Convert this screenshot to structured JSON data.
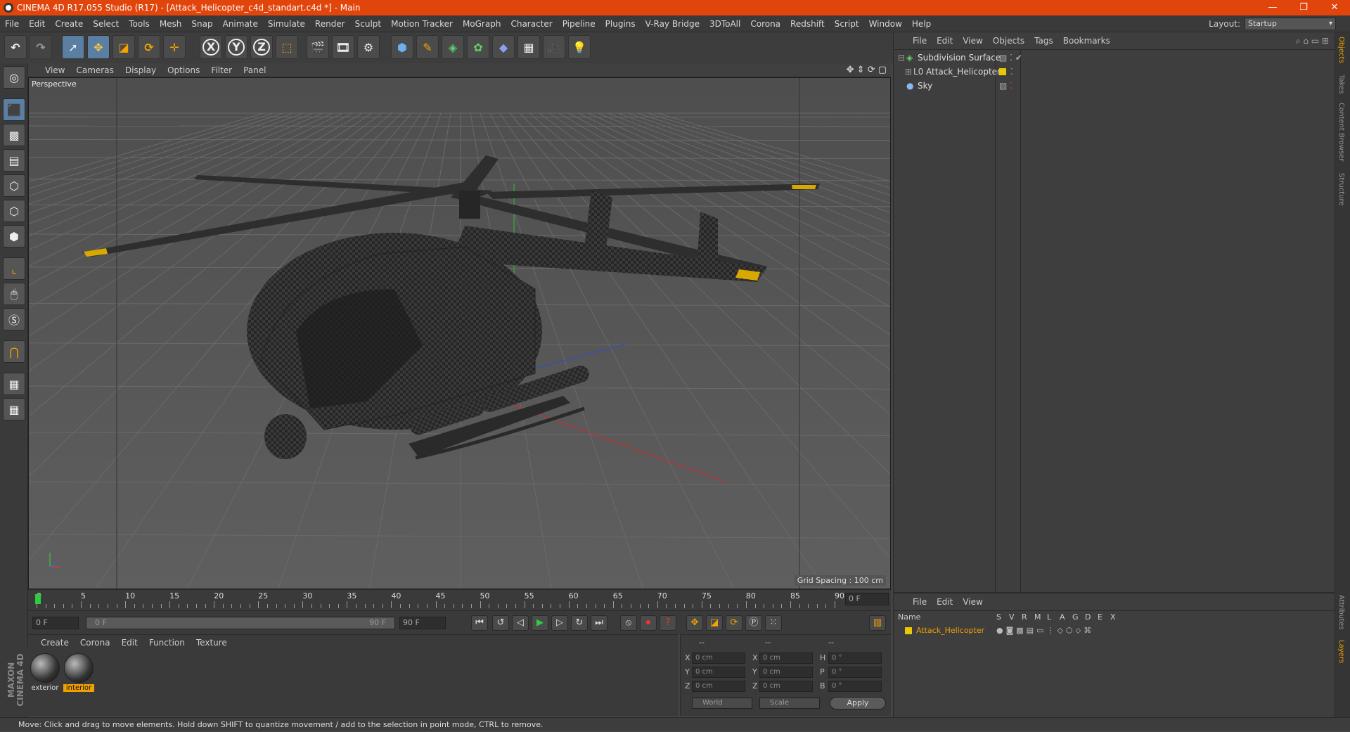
{
  "window": {
    "title": "CINEMA 4D R17.055 Studio (R17) - [Attack_Helicopter_c4d_standart.c4d *] - Main",
    "minimize": "—",
    "restore": "❐",
    "close": "✕"
  },
  "menu": [
    "File",
    "Edit",
    "Create",
    "Select",
    "Tools",
    "Mesh",
    "Snap",
    "Animate",
    "Simulate",
    "Render",
    "Sculpt",
    "Motion Tracker",
    "MoGraph",
    "Character",
    "Pipeline",
    "Plugins",
    "V-Ray Bridge",
    "3DToAll",
    "Corona",
    "Redshift",
    "Script",
    "Window",
    "Help"
  ],
  "layout": {
    "label": "Layout:",
    "value": "Startup"
  },
  "toolbar": {
    "x": "X",
    "y": "Y",
    "z": "Z"
  },
  "viewport": {
    "menu": [
      "View",
      "Cameras",
      "Display",
      "Options",
      "Filter",
      "Panel"
    ],
    "label": "Perspective",
    "grid_spacing": "Grid Spacing : 100 cm"
  },
  "timeline": {
    "ticks": [
      "0",
      "5",
      "10",
      "15",
      "20",
      "25",
      "30",
      "35",
      "40",
      "45",
      "50",
      "55",
      "60",
      "65",
      "70",
      "75",
      "80",
      "85",
      "90"
    ],
    "current_frame": "0 F",
    "start_field": "0 F",
    "range_start": "0 F",
    "range_end": "90 F",
    "end_field": "90 F"
  },
  "material_panel": {
    "menu": [
      "Create",
      "Corona",
      "Edit",
      "Function",
      "Texture"
    ],
    "materials": [
      "exterior",
      "interior"
    ]
  },
  "coords": {
    "headers": [
      "--",
      "--",
      "--"
    ],
    "rows": [
      {
        "a": "X",
        "av": "0 cm",
        "b": "X",
        "bv": "0 cm",
        "c": "H",
        "cv": "0 °"
      },
      {
        "a": "Y",
        "av": "0 cm",
        "b": "Y",
        "bv": "0 cm",
        "c": "P",
        "cv": "0 °"
      },
      {
        "a": "Z",
        "av": "0 cm",
        "b": "Z",
        "bv": "0 cm",
        "c": "B",
        "cv": "0 °"
      }
    ],
    "world": "World",
    "scale": "Scale",
    "apply": "Apply"
  },
  "object_manager": {
    "menu": [
      "File",
      "Edit",
      "View",
      "Objects",
      "Tags",
      "Bookmarks"
    ],
    "objects": [
      "Subdivision Surface",
      "Attack_Helicopter",
      "Sky"
    ]
  },
  "layer_manager": {
    "menu": [
      "File",
      "Edit",
      "View"
    ],
    "columns": [
      "Name",
      "S",
      "V",
      "R",
      "M",
      "L",
      "A",
      "G",
      "D",
      "E",
      "X"
    ],
    "layer": "Attack_Helicopter"
  },
  "right_tabs": [
    "Objects",
    "Takes",
    "Content Browser",
    "Structure",
    "Attributes",
    "Layers"
  ],
  "status": "Move: Click and drag to move elements. Hold down SHIFT to quantize movement / add to the selection in point mode, CTRL to remove.",
  "brand": "MAXON CINEMA 4D",
  "colors": {
    "accent": "#e2450c",
    "selection": "#f0a000",
    "layer_yellow": "#e8c800"
  }
}
